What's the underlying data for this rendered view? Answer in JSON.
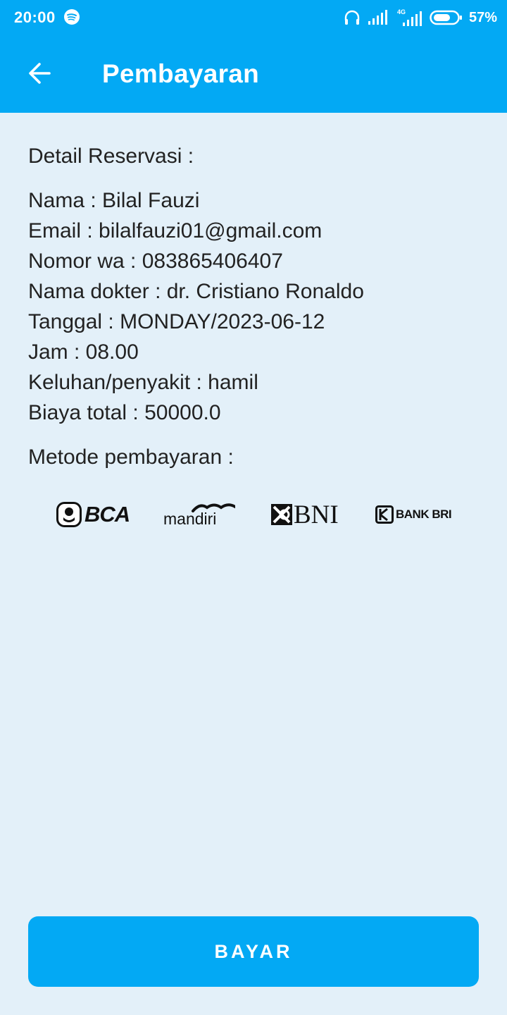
{
  "status_bar": {
    "time": "20:00",
    "network": "4G",
    "battery": "57%",
    "icons": [
      "spotify-icon",
      "headphones-icon",
      "signal-icon",
      "signal-4g-icon",
      "battery-icon"
    ]
  },
  "header": {
    "title": "Pembayaran",
    "back_icon": "arrow-left-icon"
  },
  "details": {
    "heading": "Detail Reservasi :",
    "lines": [
      "Nama : Bilal Fauzi",
      "Email : bilalfauzi01@gmail.com",
      "Nomor wa : 083865406407",
      "Nama dokter : dr. Cristiano Ronaldo",
      "Tanggal : MONDAY/2023-06-12",
      "Jam : 08.00",
      "Keluhan/penyakit : hamil",
      "Biaya total : 50000.0"
    ]
  },
  "payment": {
    "heading": "Metode pembayaran :",
    "banks": [
      "BCA",
      "mandiri",
      "BNI",
      "BANK BRI"
    ]
  },
  "action": {
    "pay_label": "BAYAR"
  },
  "colors": {
    "primary": "#03a9f4",
    "background": "#e3f0f9",
    "text": "#222222"
  }
}
